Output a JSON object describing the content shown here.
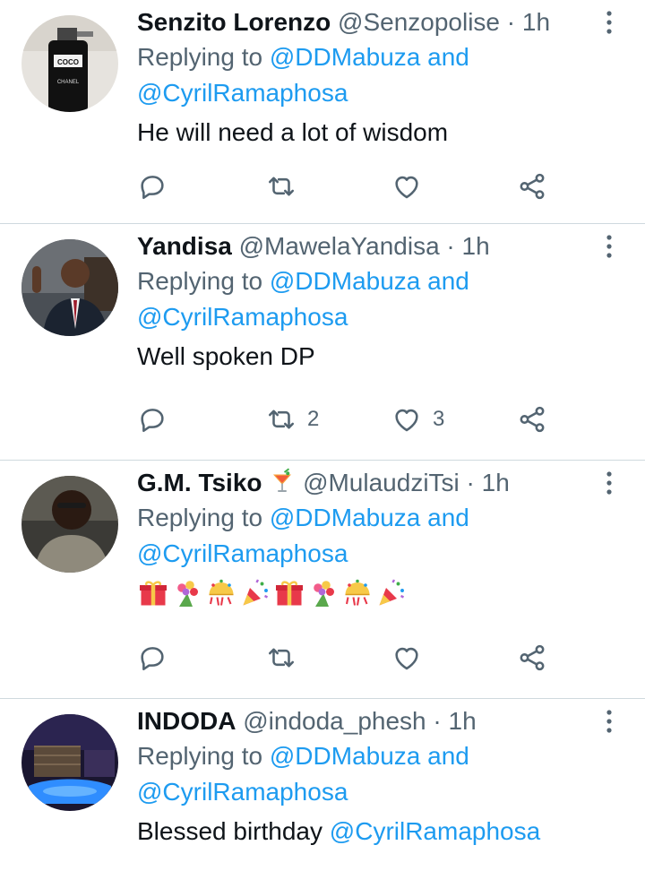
{
  "replies": [
    {
      "name": "Senzito Lorenzo",
      "handle": "@Senzopolise",
      "sep": "·",
      "time": "1h",
      "replying_prefix": "Replying to",
      "mention_1": "@DDMabuza",
      "mention_and": "and",
      "mention_2": "@CyrilRamaphosa",
      "text": "He will need a lot of wisdom",
      "retweets": "",
      "likes": "",
      "avatar_icon": "perfume-bottle-avatar"
    },
    {
      "name": "Yandisa",
      "handle": "@MawelaYandisa",
      "sep": "·",
      "time": "1h",
      "replying_prefix": "Replying to",
      "mention_1": "@DDMabuza",
      "mention_and": "and",
      "mention_2": "@CyrilRamaphosa",
      "text": "Well spoken DP",
      "retweets": "2",
      "likes": "3",
      "avatar_icon": "man-in-suit-avatar"
    },
    {
      "name": "G.M. Tsiko",
      "name_emoji": "tropical-drink-emoji",
      "handle": "@MulaudziTsi",
      "sep": "·",
      "time": "1h",
      "replying_prefix": "Replying to",
      "mention_1": "@DDMabuza",
      "mention_and": "and",
      "mention_2": "@CyrilRamaphosa",
      "emojis": [
        "gift",
        "bouquet",
        "confetti-ball",
        "party-popper",
        "gift",
        "bouquet",
        "confetti-ball",
        "party-popper"
      ],
      "retweets": "",
      "likes": "",
      "avatar_icon": "man-portrait-avatar"
    },
    {
      "name": "INDODA",
      "handle": "@indoda_phesh",
      "sep": "·",
      "time": "1h",
      "replying_prefix": "Replying to",
      "mention_1": "@DDMabuza",
      "mention_and": "and",
      "mention_2": "@CyrilRamaphosa",
      "text_prefix": "Blessed birthday",
      "text_mention": "@CyrilRamaphosa",
      "avatar_icon": "night-pool-avatar"
    }
  ],
  "colors": {
    "accent": "#1d9bf0",
    "secondary": "#536471",
    "primary_text": "#0f1419",
    "divider": "#cfd9de"
  },
  "icons": {
    "reply": "reply-bubble-icon",
    "retweet": "retweet-icon",
    "like": "heart-icon",
    "share": "share-icon",
    "more": "more-options-icon"
  }
}
